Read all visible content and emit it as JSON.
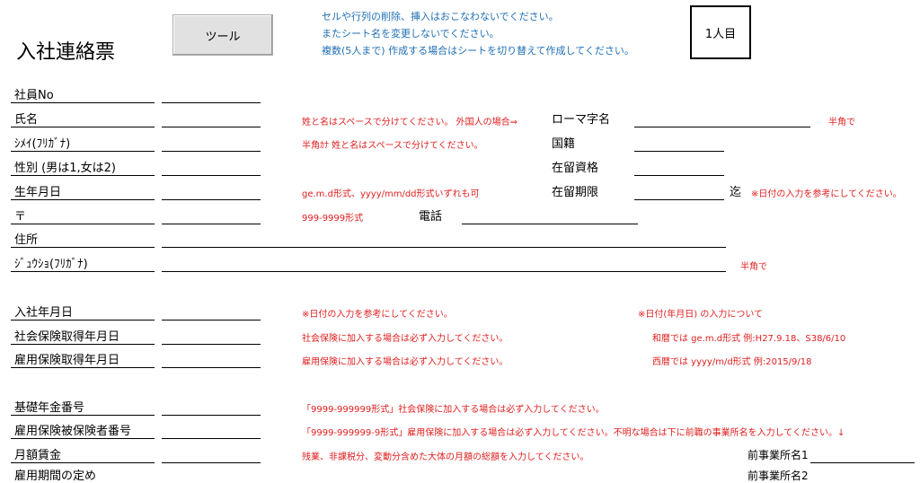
{
  "header": {
    "title": "入社連絡票",
    "tool_button": "ツール",
    "notices": [
      "セルや行列の削除、挿入はおこなわないでください。",
      "またシート名を変更しないでください。",
      "複数(5人まで) 作成する場合はシートを切り替えて作成してください。"
    ],
    "sheet_label": "1人目"
  },
  "fields": {
    "employee_no": "社員No",
    "name": "氏名",
    "name_kana": "ｼﾒｲ(ﾌﾘｶﾞﾅ)",
    "gender": "性別 (男は1,女は2)",
    "birthdate": "生年月日",
    "postal": "〒",
    "address": "住所",
    "address_kana": "ｼﾞｭｳｼｮ(ﾌﾘｶﾞﾅ)",
    "hire_date": "入社年月日",
    "social_insurance_date": "社会保険取得年月日",
    "employment_insurance_date": "雇用保険取得年月日",
    "pension_no": "基礎年金番号",
    "employment_insurance_no": "雇用保険被保険者番号",
    "monthly_wage": "月額賃金",
    "contract_period": "雇用期間の定め"
  },
  "right_fields": {
    "romaji": "ローマ字名",
    "nationality": "国籍",
    "residence_status": "在留資格",
    "residence_period": "在留期限",
    "until": "迄",
    "phone": "電話",
    "prev_company1": "前事業所名1",
    "prev_company2": "前事業所名2"
  },
  "notes": {
    "name": "姓と名はスペースで分けてください。 外国人の場合⇒",
    "romaji_hankaku": "半角で",
    "kana": "半角ｶﾅ 姓と名はスペースで分けてください。",
    "birth_format": "ge.m.d形式、yyyy/mm/dd形式いずれも可",
    "period_note": "※日付の入力を参考にしてください。",
    "postal_format": "999-9999形式",
    "address_kana_hankaku": "半角で",
    "hire_note": "※日付の入力を参考にしてください。",
    "date_input_about": "※日付(年月日) の入力について",
    "social_note": "社会保険に加入する場合は必ず入力してください。",
    "wareki": "和暦では ge.m.d形式 例:H27.9.18、S38/6/10",
    "employment_note": "雇用保険に加入する場合は必ず入力してください。",
    "seireki": "西暦では yyyy/m/d形式 例:2015/9/18",
    "pension_format": "「9999-999999形式」社会保険に加入する場合は必ず入力してください。",
    "employment_no_format": "「9999-999999-9形式」雇用保険に加入する場合は必ず入力してください。不明な場合は下に前職の事業所名を入力してください。↓",
    "wage_note": "残業、非課税分、変動分含めた大体の月額の総額を入力してください。"
  }
}
